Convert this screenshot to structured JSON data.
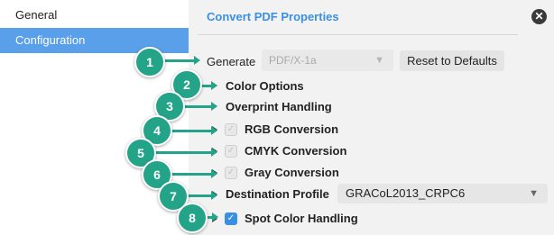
{
  "sidebar": {
    "items": [
      {
        "label": "General"
      },
      {
        "label": "Configuration"
      }
    ]
  },
  "panel": {
    "title": "Convert PDF Properties",
    "generate": {
      "label": "Generate",
      "value": "PDF/X-1a",
      "reset_label": "Reset to Defaults"
    },
    "rows": {
      "color_options": "Color Options",
      "overprint": "Overprint Handling",
      "rgb": "RGB Conversion",
      "cmyk": "CMYK Conversion",
      "gray": "Gray Conversion",
      "destination": "Destination Profile",
      "spot": "Spot Color Handling"
    },
    "destination_value": "GRACoL2013_CRPC6"
  },
  "callouts": [
    "1",
    "2",
    "3",
    "4",
    "5",
    "6",
    "7",
    "8"
  ],
  "colors": {
    "accent": "#3b8fe0",
    "callout": "#23a488",
    "selected": "#5a9fe9"
  }
}
